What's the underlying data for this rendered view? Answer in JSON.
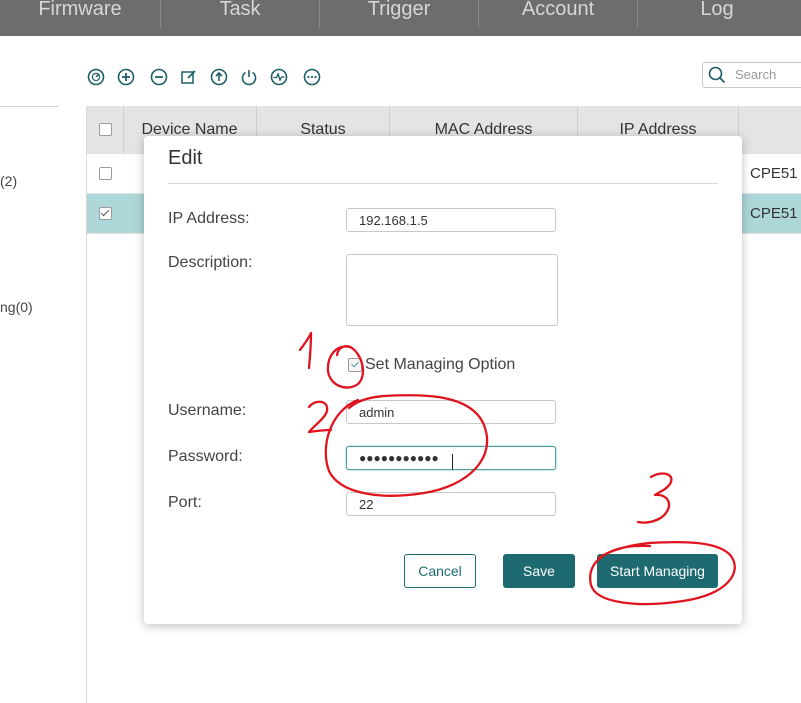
{
  "nav": {
    "tabs": [
      "Firmware",
      "Task",
      "Trigger",
      "Account",
      "Log"
    ]
  },
  "left_panel": {
    "item_a": "(2)",
    "item_b": "ng(0)"
  },
  "toolbar": {
    "icons": [
      "gauge-icon",
      "plus-circle-icon",
      "minus-circle-icon",
      "edit-icon",
      "upload-icon",
      "power-icon",
      "activity-icon",
      "more-icon"
    ]
  },
  "search": {
    "placeholder": "Search"
  },
  "table": {
    "headers": [
      "Device Name",
      "Status",
      "MAC Address",
      "IP Address"
    ],
    "rows": [
      {
        "model": "CPE51",
        "checked": false
      },
      {
        "model": "CPE51",
        "checked": true
      }
    ]
  },
  "modal": {
    "title": "Edit",
    "ip_label": "IP Address:",
    "ip_value": "192.168.1.5",
    "desc_label": "Description:",
    "desc_value": "",
    "option_label": "Set Managing Option",
    "username_label": "Username:",
    "username_value": "admin",
    "password_label": "Password:",
    "password_value": "●●●●●●●●●●●",
    "port_label": "Port:",
    "port_value": "22",
    "cancel_label": "Cancel",
    "save_label": "Save",
    "start_label": "Start Managing"
  },
  "annotations": {
    "n1": "1",
    "n2": "2",
    "n3": "3"
  },
  "colors": {
    "accent": "#1d6a70",
    "annotation": "#e0141e",
    "selected_row": "#aed7d9",
    "nav_bg": "#6d6d6d"
  }
}
